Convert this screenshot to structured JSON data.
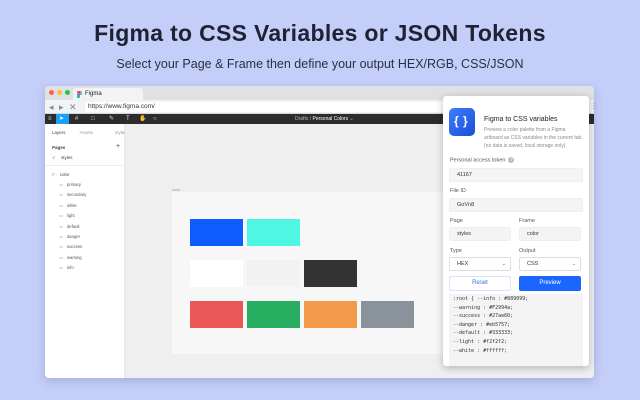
{
  "header": {
    "title": "Figma to CSS Variables or JSON Tokens",
    "subtitle": "Select your Page & Frame then define your output HEX/RGB, CSS/JSON"
  },
  "browser": {
    "tab_title": "Figma",
    "url": "https://www.figma.com/",
    "traffic_lights": [
      "#ff5f57",
      "#febc2e",
      "#28c840"
    ]
  },
  "figma": {
    "breadcrumb_parent": "Drafts",
    "breadcrumb_separator": "/",
    "file_name": "Personal Colors",
    "sidebar": {
      "tabs": [
        "Layers",
        "Assets",
        "styles"
      ],
      "pages_label": "Pages",
      "add_icon": "+",
      "current_page": "styles",
      "frame_name": "color",
      "layers": [
        "primary",
        "secondary",
        "white",
        "light",
        "default",
        "danger",
        "success",
        "warning",
        "info"
      ]
    },
    "swatches": [
      [
        "#0d5cfb",
        "#4ef7e1"
      ],
      [
        "#ffffff",
        "#f2f2f2",
        "#333333"
      ],
      [
        "#eb5757",
        "#27ae60",
        "#f2994a",
        "#8a929c"
      ]
    ]
  },
  "extension": {
    "title": "Figma to CSS variables",
    "description": "Preview a color palette from a Figma artboard as CSS variables in the current tab. (no data is saved, local storage only)",
    "token_label": "Personal access token",
    "token_value": "41167",
    "file_id_label": "File ID",
    "file_id_value": "GoVn8",
    "page_label": "Page",
    "page_value": "styles",
    "frame_label": "Frame",
    "frame_value": "color",
    "type_label": "Type",
    "type_value": "HEX",
    "output_label": "Output",
    "output_value": "CSS",
    "reset_label": "Reset",
    "preview_label": "Preview",
    "code_lines": [
      ":root { --info : #889099;",
      "--warning : #F2994a;",
      "--success : #27ae60;",
      "--danger : #eb5757;",
      "--default : #333333;",
      "--light : #f2f2f2;",
      "--white : #ffffff;"
    ]
  }
}
